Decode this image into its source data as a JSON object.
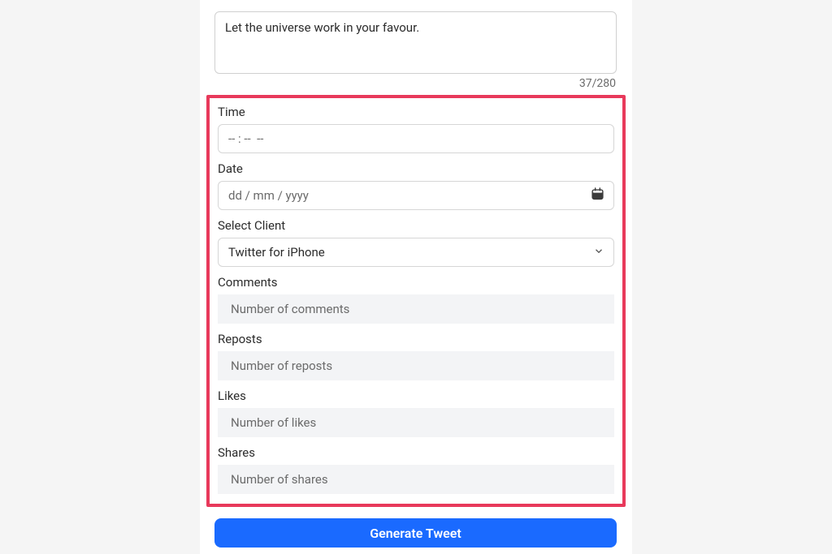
{
  "tweet": {
    "content": "Let the universe work in your favour.",
    "char_count": "37/280"
  },
  "form": {
    "time": {
      "label": "Time",
      "placeholder": "-- : --  --"
    },
    "date": {
      "label": "Date",
      "placeholder": "dd / mm / yyyy"
    },
    "client": {
      "label": "Select Client",
      "selected": "Twitter for iPhone"
    },
    "comments": {
      "label": "Comments",
      "placeholder": "Number of comments"
    },
    "reposts": {
      "label": "Reposts",
      "placeholder": "Number of reposts"
    },
    "likes": {
      "label": "Likes",
      "placeholder": "Number of likes"
    },
    "shares": {
      "label": "Shares",
      "placeholder": "Number of shares"
    }
  },
  "button": {
    "generate": "Generate Tweet"
  }
}
